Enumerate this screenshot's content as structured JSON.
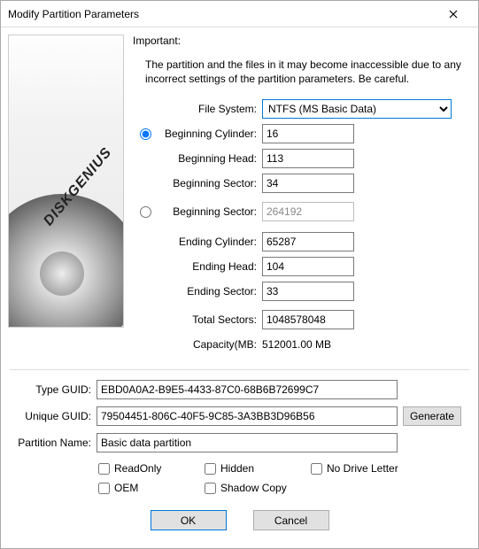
{
  "title": "Modify Partition Parameters",
  "important_label": "Important:",
  "intro_text": "The partition and the files in it may become inaccessible due to any incorrect settings of the partition parameters. Be careful.",
  "brand": "DISKGENIUS",
  "labels": {
    "file_system": "File System:",
    "beg_cyl": "Beginning Cylinder:",
    "beg_head": "Beginning Head:",
    "beg_sector": "Beginning Sector:",
    "beg_sector2": "Beginning Sector:",
    "end_cyl": "Ending Cylinder:",
    "end_head": "Ending Head:",
    "end_sector": "Ending Sector:",
    "total_sectors": "Total Sectors:",
    "capacity": "Capacity(MB:",
    "type_guid": "Type GUID:",
    "unique_guid": "Unique GUID:",
    "partition_name": "Partition Name:",
    "generate": "Generate",
    "readonly": "ReadOnly",
    "hidden": "Hidden",
    "no_drive_letter": "No Drive Letter",
    "oem": "OEM",
    "shadow_copy": "Shadow Copy",
    "ok": "OK",
    "cancel": "Cancel"
  },
  "values": {
    "file_system_selected": "NTFS (MS Basic Data)",
    "beg_cyl": "16",
    "beg_head": "113",
    "beg_sector": "34",
    "beg_sector2": "264192",
    "end_cyl": "65287",
    "end_head": "104",
    "end_sector": "33",
    "total_sectors": "1048578048",
    "capacity": "512001.00 MB",
    "type_guid": "EBD0A0A2-B9E5-4433-87C0-68B6B72699C7",
    "unique_guid": "79504451-806C-40F5-9C85-3A3BB3D96B56",
    "partition_name": "Basic data partition"
  },
  "checks": {
    "readonly": false,
    "hidden": false,
    "no_drive_letter": false,
    "oem": false,
    "shadow_copy": false
  },
  "radio_mode": "chs"
}
